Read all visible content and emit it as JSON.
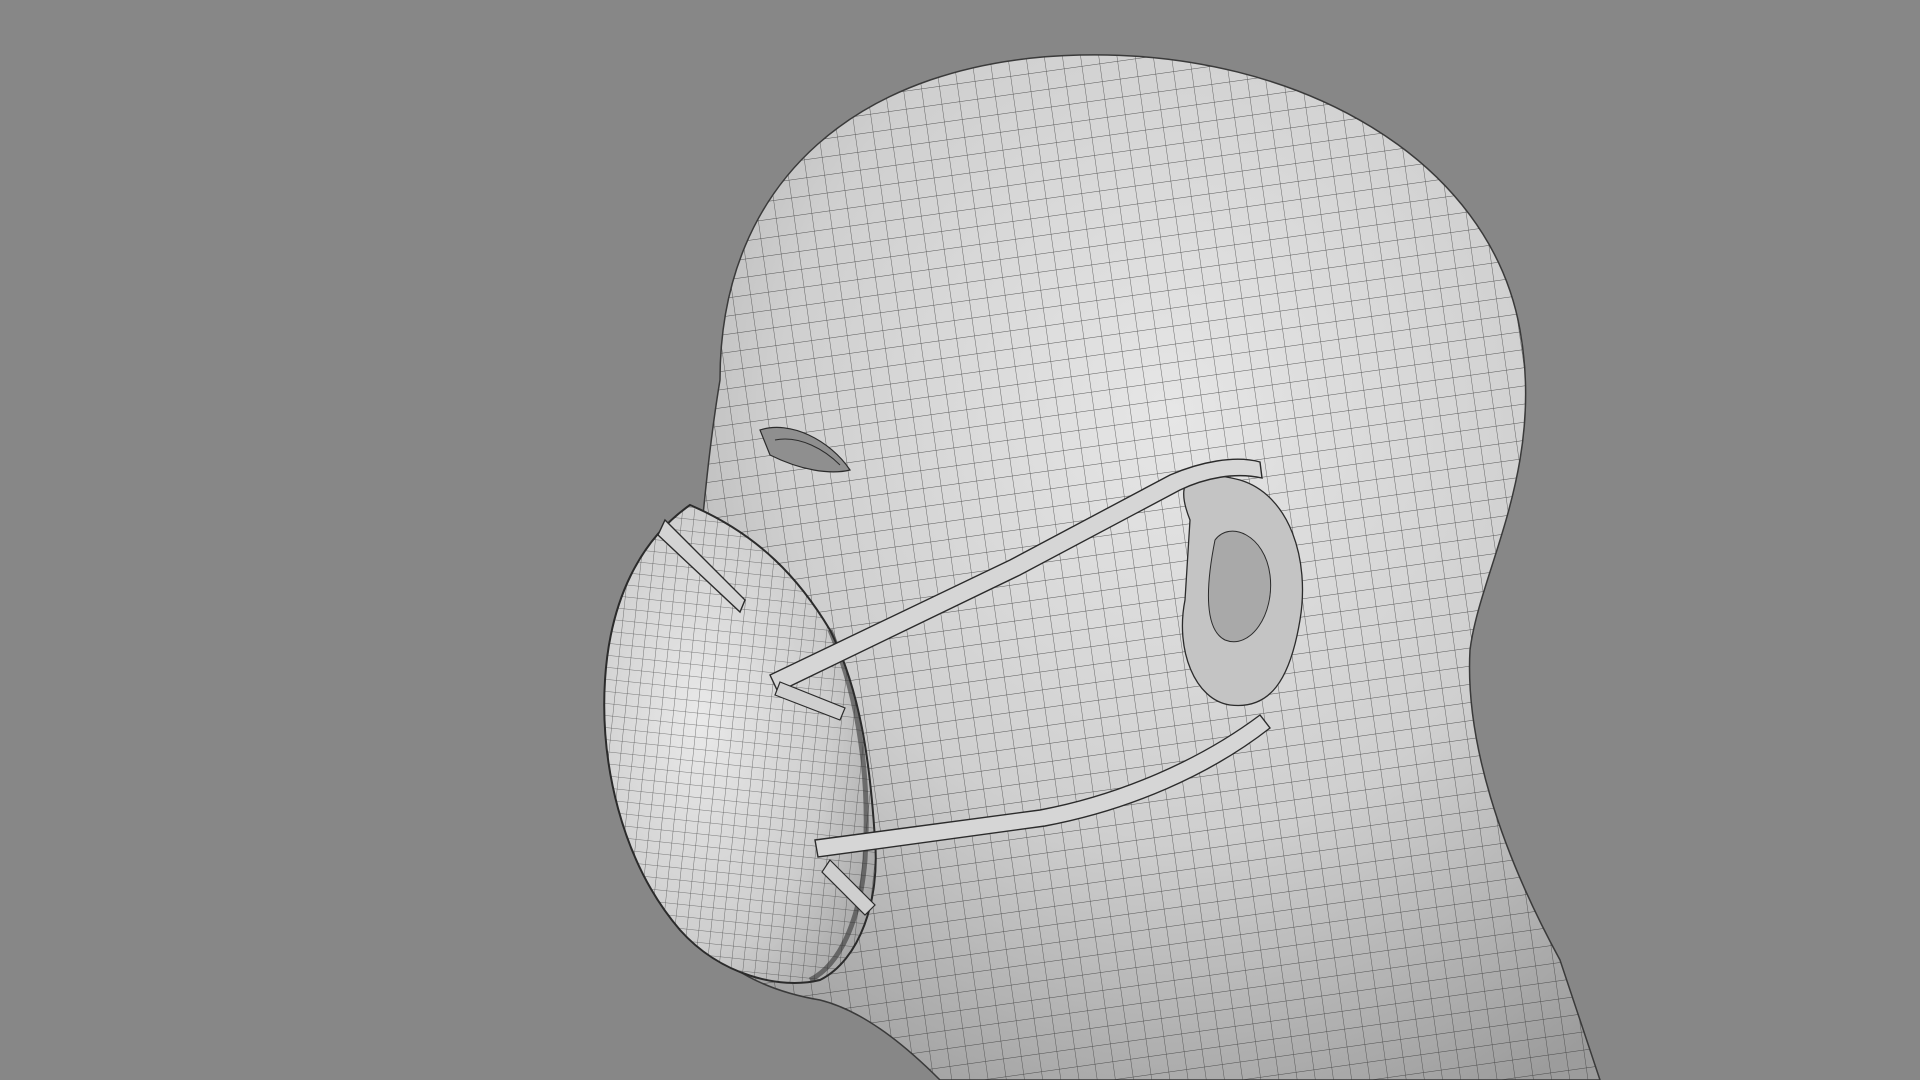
{
  "viewport": {
    "background_color": "#878787",
    "mesh_surface_color": "#cfcfcf",
    "wire_color": "#2b2b2b"
  },
  "subject": {
    "kind": "wireframe-head-with-respirator-mask",
    "parts": [
      "head",
      "ear",
      "eye",
      "respirator-mask",
      "upper-strap",
      "lower-strap",
      "nose-clip"
    ]
  }
}
